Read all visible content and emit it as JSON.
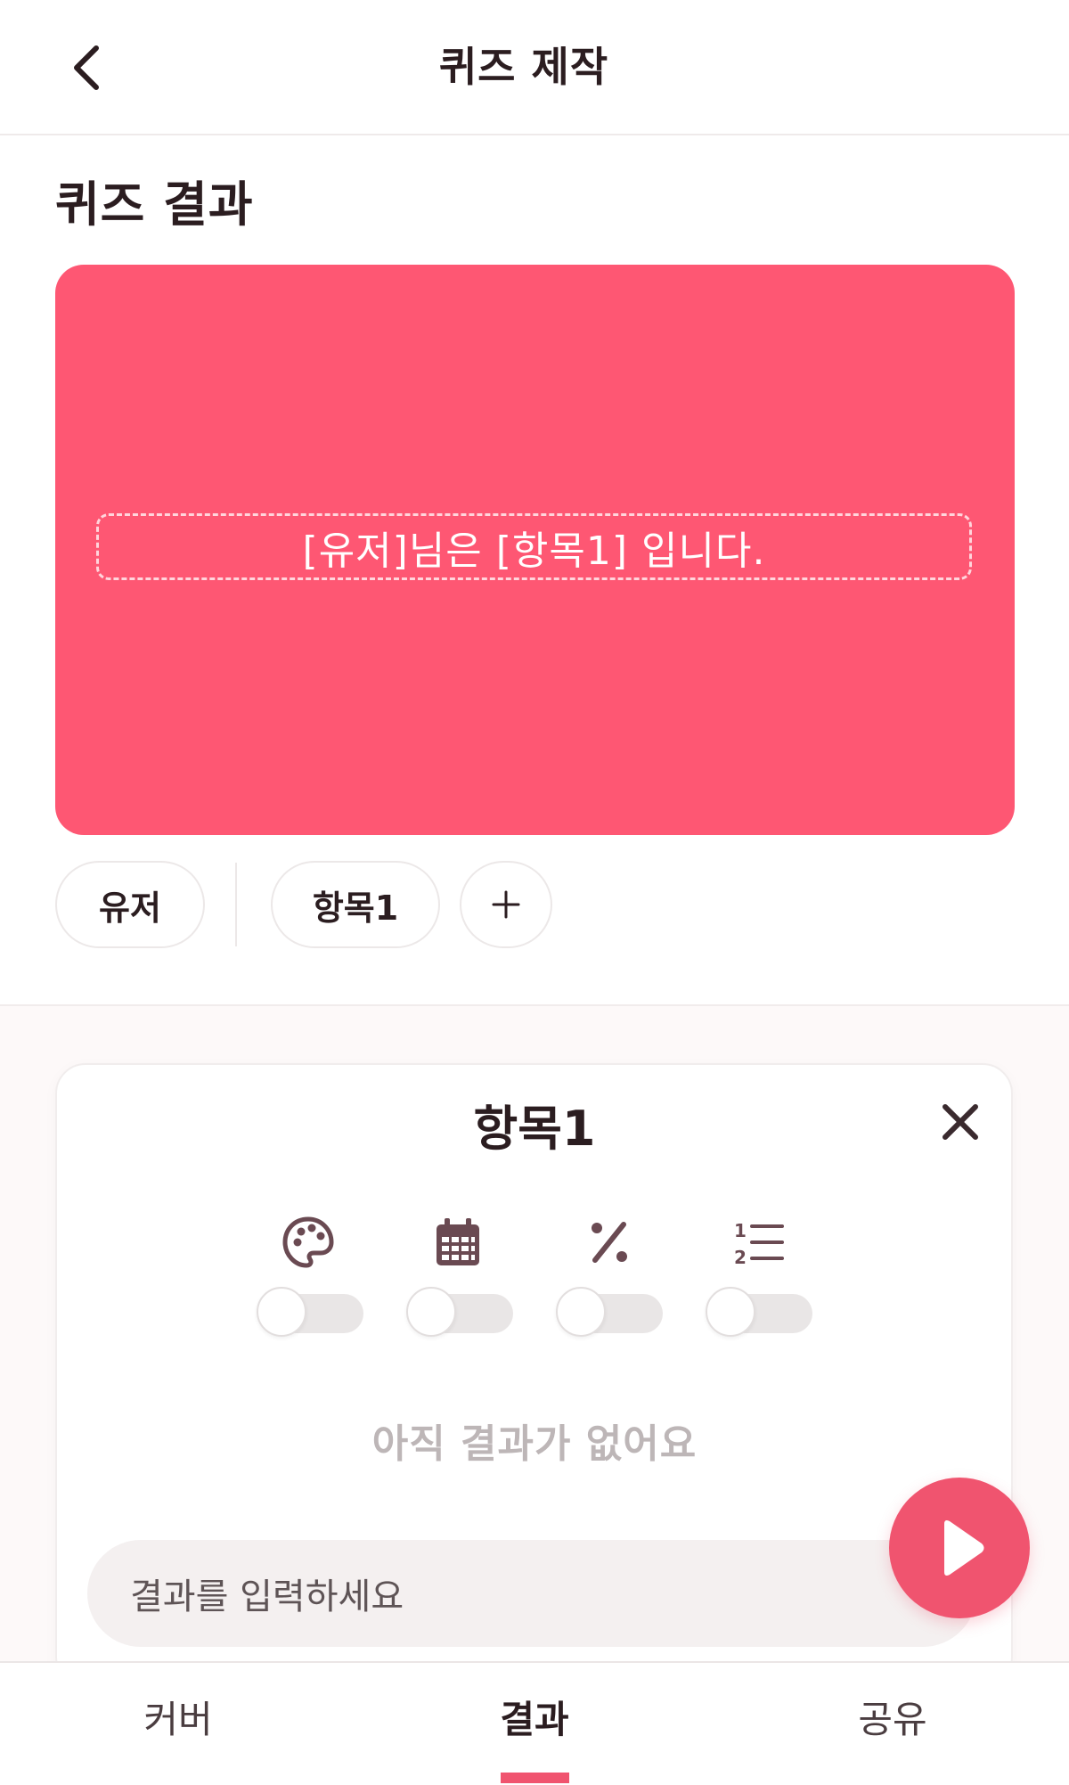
{
  "header": {
    "title": "퀴즈 제작",
    "back_icon": "chevron-left-icon"
  },
  "section_title": "퀴즈 결과",
  "result_card": {
    "text": "[유저]님은 [항목1] 입니다.",
    "background_color": "#fe5773"
  },
  "chips": [
    {
      "label": "유저"
    },
    {
      "label": "항목1"
    },
    {
      "label": "+",
      "icon": "plus-icon"
    }
  ],
  "item_panel": {
    "title": "항목1",
    "close_icon": "close-icon",
    "options": [
      {
        "icon": "palette-icon",
        "enabled": false
      },
      {
        "icon": "calendar-icon",
        "enabled": false
      },
      {
        "icon": "percent-icon",
        "enabled": false
      },
      {
        "icon": "numbered-list-icon",
        "enabled": false
      }
    ],
    "empty_message": "아직 결과가 없어요",
    "input_placeholder": "결과를 입력하세요",
    "submit_icon": "play-icon"
  },
  "tabs": [
    {
      "label": "커버",
      "active": false
    },
    {
      "label": "결과",
      "active": true
    },
    {
      "label": "공유",
      "active": false
    }
  ],
  "colors": {
    "accent": "#f0546f",
    "text": "#2b1d20",
    "icon": "#6a4a52"
  }
}
